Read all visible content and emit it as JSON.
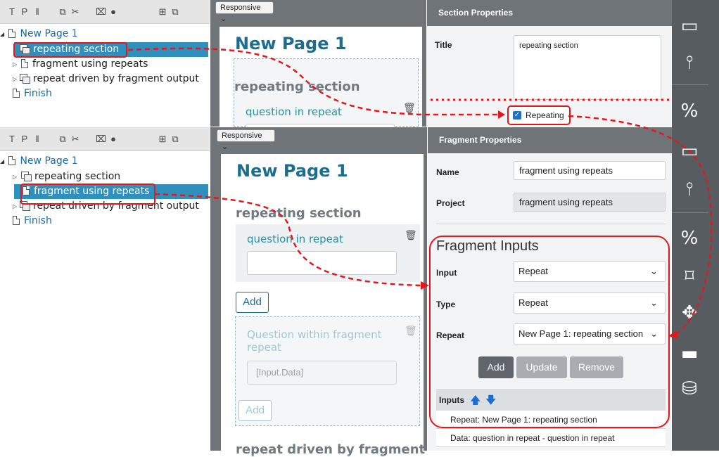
{
  "top": {
    "tree": {
      "items": [
        "New Page 1",
        "repeating section",
        "fragment using repeats",
        "repeat driven by fragment output",
        "Finish"
      ]
    },
    "canvas": {
      "responsive": "Responsive",
      "page_title": "New Page 1",
      "section_title": "repeating section",
      "question": "question in repeat"
    },
    "props": {
      "header": "Section Properties",
      "title_label": "Title",
      "title_value": "repeating section",
      "repeating_label": "Repeating",
      "repeating_checked": true
    }
  },
  "bottom": {
    "tree": {
      "items": [
        "New Page 1",
        "repeating section",
        "fragment using repeats",
        "repeat driven by fragment output",
        "Finish"
      ]
    },
    "canvas": {
      "responsive": "Responsive",
      "page_title": "New Page 1",
      "section_title": "repeating section",
      "question": "question in repeat",
      "add": "Add",
      "fragment_question": "Question within fragment repeat",
      "fragment_input_value": "[Input.Data]",
      "add2": "Add",
      "cutoff": "repeat driven by fragment"
    },
    "props": {
      "header": "Fragment Properties",
      "name_label": "Name",
      "name_value": "fragment using repeats",
      "project_label": "Project",
      "project_value": "fragment using repeats",
      "inputs_title": "Fragment Inputs",
      "input_label": "Input",
      "input_value": "Repeat",
      "type_label": "Type",
      "type_value": "Repeat",
      "repeat_label": "Repeat",
      "repeat_value": "New Page 1: repeating section",
      "btn_add": "Add",
      "btn_update": "Update",
      "btn_remove": "Remove",
      "inputs_header": "Inputs",
      "rows": [
        "Repeat: New Page 1: repeating section",
        "Data: question in repeat - question in repeat"
      ]
    }
  },
  "toolbar_glyphs": [
    "T",
    "P",
    "I",
    "⧉",
    "✂",
    "🗑",
    "⓿",
    "⊞",
    "⧉"
  ],
  "rail_icons": [
    "input-box-icon",
    "split-icon",
    "percent-code-icon",
    "bookmark-icon",
    "move-icon",
    "folder-icon",
    "database-icon"
  ],
  "colors": {
    "accent": "#1d6d8e",
    "selection": "#2f8fbd",
    "annotation": "#e0191e",
    "rail": "#575c61"
  }
}
